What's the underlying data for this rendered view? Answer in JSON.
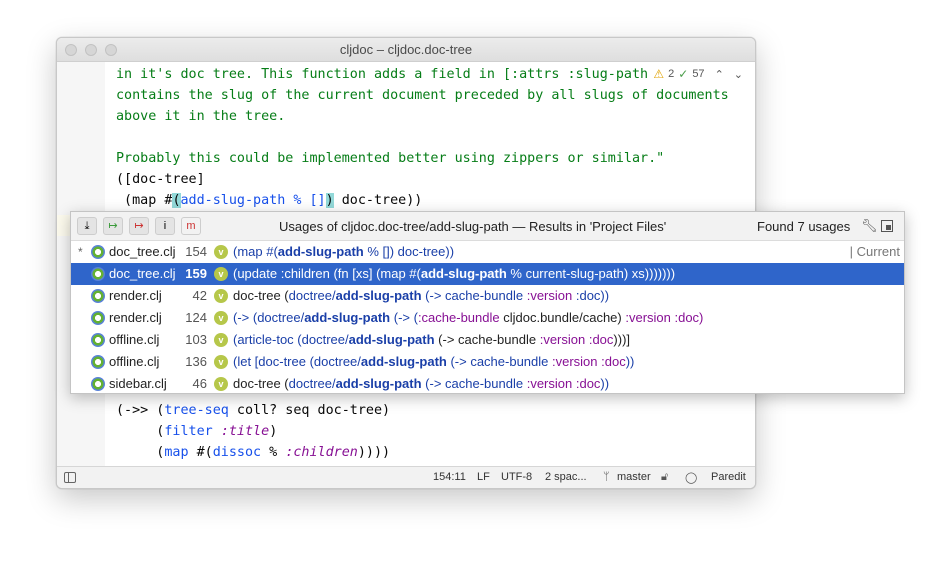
{
  "window": {
    "title": "cljdoc – cljdoc.doc-tree"
  },
  "inspections": {
    "warnings": "2",
    "checks": "57"
  },
  "code": {
    "l1": "in it's doc tree. This function adds a field in [:attrs :slug-path",
    "l2": "contains the slug of the current document preceded by all slugs of documents",
    "l3": "above it in the tree.",
    "l4": "Probably this could be implemented better using zippers or similar.\"",
    "l5": "([doc-tree]",
    "l6a": " (map #",
    "l6b": "(",
    "l6c": "add-slug-path % []",
    "l6d": ")",
    "l6e": " doc-tree))",
    "l7a": "(->> (",
    "l7b": "tree-seq",
    "l7c": " coll? seq doc-tree)",
    "l8a": "     (",
    "l8b": "filter",
    "l8c": " ",
    "l8d": ":title",
    "l8e": ")",
    "l9a": "     (",
    "l9b": "map",
    "l9c": " #(",
    "l9d": "dissoc",
    "l9e": " % ",
    "l9f": ":children",
    "l9g": "))))"
  },
  "popup": {
    "title": "Usages of cljdoc.doc-tree/add-slug-path — Results in 'Project Files'",
    "found": "Found 7 usages",
    "current_label": "| Current",
    "rows": [
      {
        "star": "*",
        "file": "doc_tree.clj",
        "line": "154",
        "p": [
          "(map #(",
          "add-slug-path",
          " % []) doc-tree))",
          "",
          "",
          "",
          ""
        ]
      },
      {
        "star": "",
        "file": "doc_tree.clj",
        "line": "159",
        "p": [
          "(update :children (fn [xs] (map #(",
          "add-slug-path",
          " % current-slug-path) xs)))))))",
          "",
          "",
          "",
          ""
        ]
      },
      {
        "star": "",
        "file": "render.clj",
        "line": "42",
        "p": [
          "doc-tree (",
          "doctree/",
          "add-slug-path",
          " (-> cache-bundle ",
          ":version",
          " :doc))",
          ""
        ]
      },
      {
        "star": "",
        "file": "render.clj",
        "line": "124",
        "p": [
          "(-> (",
          "doctree/",
          "add-slug-path",
          " (-> (",
          ":cache-bundle",
          " cljdoc.bundle/cache) ",
          ":version :doc)"
        ]
      },
      {
        "star": "",
        "file": "offline.clj",
        "line": "103",
        "p": [
          "(article-toc (",
          "doctree/",
          "add-slug-path",
          " (-> cache-bundle ",
          ":version :doc",
          ")))]",
          ""
        ]
      },
      {
        "star": "",
        "file": "offline.clj",
        "line": "136",
        "p": [
          "(let [doc-tree    (",
          "doctree/",
          "add-slug-path",
          " (-> cache-bundle ",
          ":version :doc",
          "))",
          ""
        ]
      },
      {
        "star": "",
        "file": "sidebar.clj",
        "line": "46",
        "p": [
          "doc-tree (",
          "doctree/",
          "add-slug-path",
          " (-> cache-bundle ",
          ":version :doc",
          "))",
          ""
        ]
      }
    ]
  },
  "status": {
    "position": "154:11",
    "line_sep": "LF",
    "encoding": "UTF-8",
    "indent": "2 spac...",
    "branch": "master",
    "mode": "Paredit"
  },
  "colors": {
    "selection": "#2f65ca",
    "string": "#067d17",
    "keyword": "#871094"
  }
}
